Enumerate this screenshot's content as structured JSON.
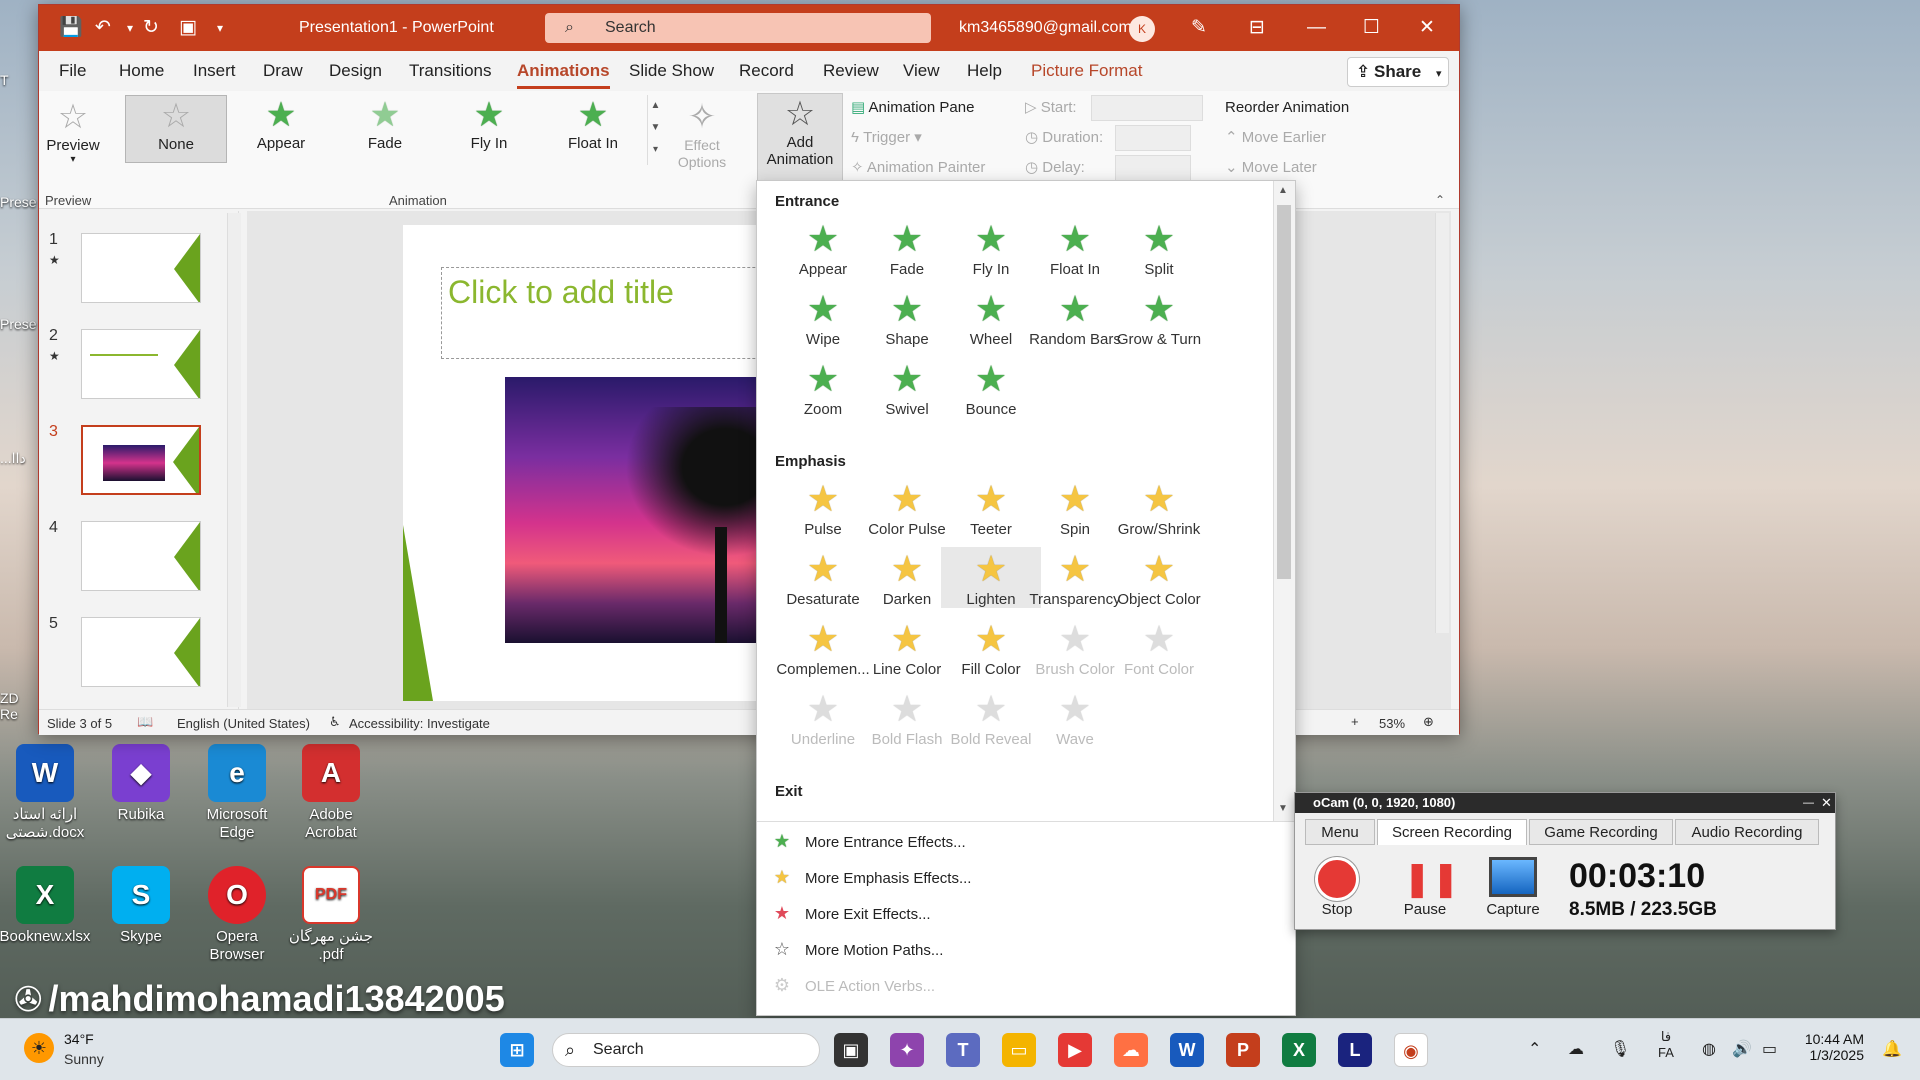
{
  "desktop": {
    "partial_labels": [
      "T",
      "Prese",
      "Prese",
      "...داا",
      "Re"
    ],
    "icons": [
      {
        "label": "ارائه استاد شصتی.docx",
        "icon": "word-doc-icon",
        "color": "#185abd",
        "glyph": "W"
      },
      {
        "label": "Rubika",
        "icon": "rubika-icon",
        "color": "#7a3fd0",
        "glyph": "◆"
      },
      {
        "label": "Microsoft Edge",
        "icon": "edge-icon",
        "color": "#1a8ad4",
        "glyph": "e"
      },
      {
        "label": "Adobe Acrobat",
        "icon": "acrobat-icon",
        "color": "#d32f2f",
        "glyph": "A"
      },
      {
        "label": "Booknew.xlsx",
        "icon": "excel-doc-icon",
        "color": "#107c41",
        "glyph": "X"
      },
      {
        "label": "Skype",
        "icon": "skype-icon",
        "color": "#00aff0",
        "glyph": "S"
      },
      {
        "label": "Opera Browser",
        "icon": "opera-icon",
        "color": "#e0222a",
        "glyph": "O"
      },
      {
        "label": "جشن مهرگان .pdf",
        "icon": "pdf-doc-icon",
        "color": "#d9372b",
        "glyph": "PDF"
      }
    ],
    "zd_label": "ZD"
  },
  "watermark": "/mahdimohamadi13842005",
  "powerpoint": {
    "title": "Presentation1 - PowerPoint",
    "search_placeholder": "Search",
    "account": "km3465890@gmail.com",
    "avatar": "K",
    "menu_tabs": [
      "File",
      "Home",
      "Insert",
      "Draw",
      "Design",
      "Transitions",
      "Animations",
      "Slide Show",
      "Record",
      "Review",
      "View",
      "Help",
      "Picture Format"
    ],
    "active_tab": "Animations",
    "share_label": "Share",
    "ribbon": {
      "preview_label": "Preview",
      "preview_group": "Preview",
      "animation_group": "Animation",
      "gallery": [
        "None",
        "Appear",
        "Fade",
        "Fly In",
        "Float In"
      ],
      "effect_options": "Effect Options",
      "add_animation": "Add Animation",
      "animation_pane": "Animation Pane",
      "trigger": "Trigger",
      "animation_painter": "Animation Painter",
      "start": "Start:",
      "duration": "Duration:",
      "delay": "Delay:",
      "reorder": "Reorder Animation",
      "move_earlier": "Move Earlier",
      "move_later": "Move Later"
    },
    "slides": [
      {
        "num": "1",
        "starred": true
      },
      {
        "num": "2",
        "starred": true
      },
      {
        "num": "3",
        "starred": false,
        "active": true
      },
      {
        "num": "4",
        "starred": false
      },
      {
        "num": "5",
        "starred": false
      }
    ],
    "title_placeholder": "Click to add title",
    "status": {
      "slide_info": "Slide 3 of 5",
      "language": "English (United States)",
      "accessibility": "Accessibility: Investigate",
      "zoom": "53%"
    }
  },
  "dropdown": {
    "entrance_title": "Entrance",
    "entrance": [
      "Appear",
      "Fade",
      "Fly In",
      "Float In",
      "Split",
      "Wipe",
      "Shape",
      "Wheel",
      "Random Bars",
      "Grow & Turn",
      "Zoom",
      "Swivel",
      "Bounce"
    ],
    "emphasis_title": "Emphasis",
    "emphasis": [
      "Pulse",
      "Color Pulse",
      "Teeter",
      "Spin",
      "Grow/Shrink",
      "Desaturate",
      "Darken",
      "Lighten",
      "Transparency",
      "Object Color",
      "Complemen...",
      "Line Color",
      "Fill Color",
      "Brush Color",
      "Font Color",
      "Underline",
      "Bold Flash",
      "Bold Reveal",
      "Wave"
    ],
    "emphasis_disabled": [
      "Brush Color",
      "Font Color",
      "Underline",
      "Bold Flash",
      "Bold Reveal",
      "Wave"
    ],
    "highlighted": "Lighten",
    "exit_title": "Exit",
    "more": [
      "More Entrance Effects...",
      "More Emphasis Effects...",
      "More Exit Effects...",
      "More Motion Paths...",
      "OLE Action Verbs..."
    ]
  },
  "ocam": {
    "title": "oCam (0, 0, 1920, 1080)",
    "tabs": [
      "Menu",
      "Screen Recording",
      "Game Recording",
      "Audio Recording"
    ],
    "active_tab": "Screen Recording",
    "buttons": [
      "Stop",
      "Pause",
      "Capture"
    ],
    "timer": "00:03:10",
    "storage": "8.5MB / 223.5GB"
  },
  "taskbar": {
    "weather_temp": "34°F",
    "weather_desc": "Sunny",
    "search": "Search",
    "time": "10:44 AM",
    "date": "1/3/2025",
    "lang_top": "فا",
    "lang_bottom": "FA"
  }
}
